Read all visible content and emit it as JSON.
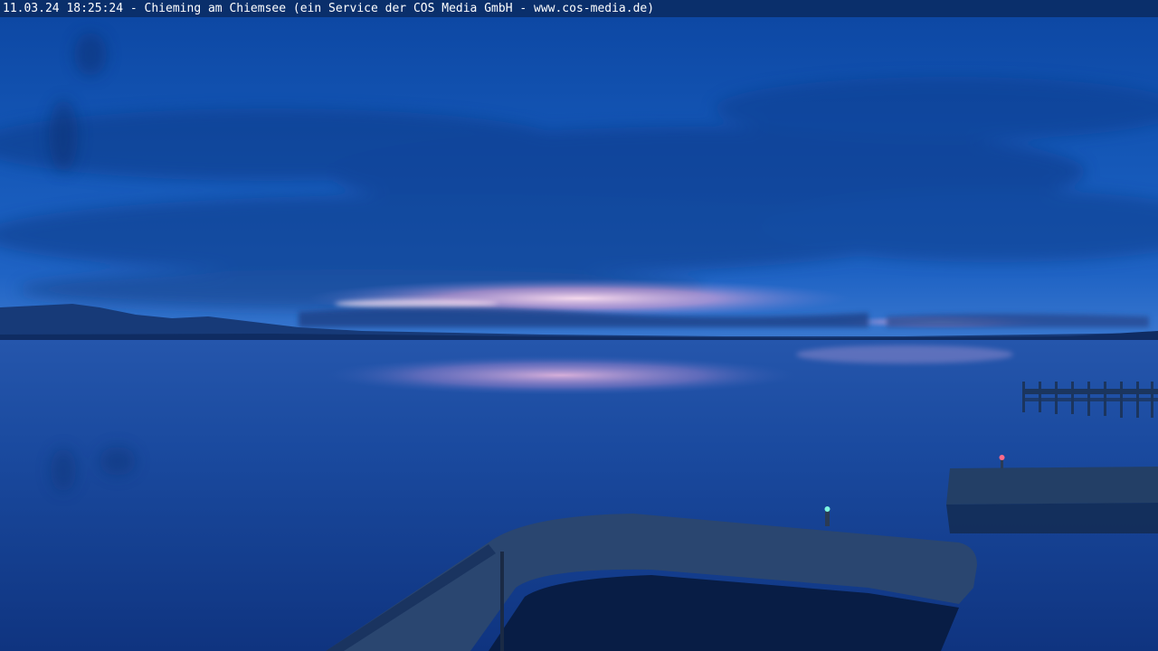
{
  "caption": {
    "text": "11.03.24 18:25:24 - Chieming am Chiemsee (ein Service der COS Media GmbH - www.cos-media.de)"
  },
  "colors": {
    "caption_bar": "#0a2f6b",
    "sky_top": "#0f4aa3",
    "sky_mid": "#1a5fc0",
    "horizon_glow": "#f3c4e6",
    "water_top": "#1d4fa6",
    "water_bottom": "#0d2d70",
    "pier": "#1f3b63"
  },
  "icons": {
    "harbor_light_green": "green-light-icon",
    "harbor_light_red": "red-light-icon"
  }
}
